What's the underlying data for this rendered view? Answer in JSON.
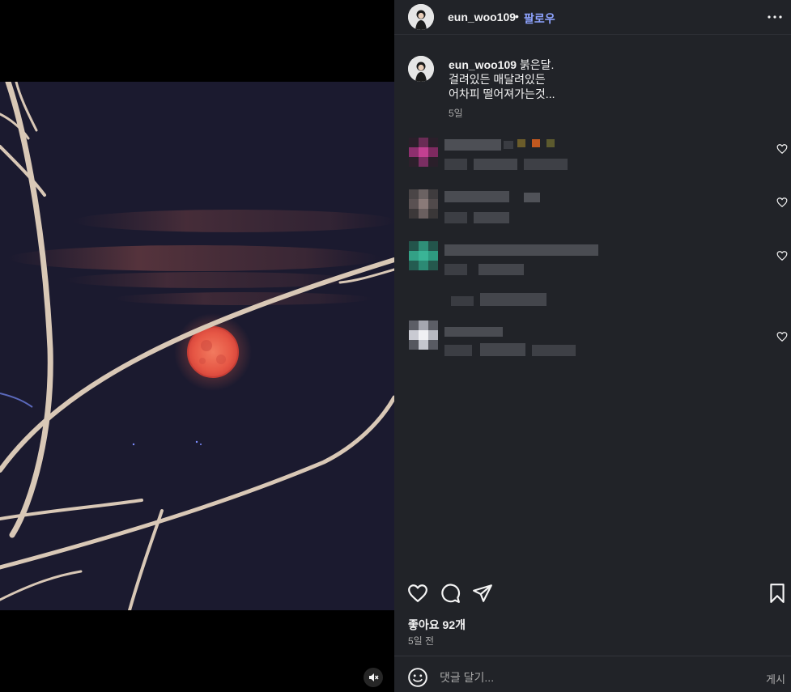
{
  "post": {
    "username": "eun_woo109",
    "follow_label": "팔로우",
    "separator": "•"
  },
  "caption": {
    "username": "eun_woo109",
    "line1": "붉은달.",
    "line2": "걸려있든 매달려있든",
    "line3": "어차피 떨어져가는것...",
    "time": "5일"
  },
  "stats": {
    "likes": "좋아요 92개",
    "date": "5일 전"
  },
  "comment_box": {
    "placeholder": "댓글 달기...",
    "post_label": "게시"
  },
  "icons": {
    "more": "more-horizontal-icon",
    "like": "heart-icon",
    "comment": "comment-icon",
    "share": "send-icon",
    "save": "bookmark-icon",
    "emoji": "emoji-icon",
    "mute": "speaker-muted-icon"
  },
  "colors": {
    "follow": "#8ea3ff",
    "panel_bg": "#212328",
    "moon": "#e9564a"
  }
}
